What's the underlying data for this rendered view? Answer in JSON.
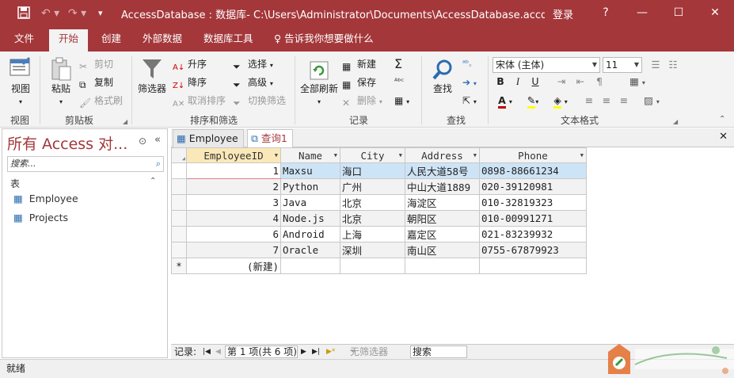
{
  "titlebar": {
    "title": "AccessDatabase : 数据库- C:\\Users\\Administrator\\Documents\\AccessDatabase.accdb (Acc...",
    "login": "登录",
    "help": "?",
    "minimize": "—",
    "restore": "☐",
    "close": "✕"
  },
  "menu": {
    "tabs": [
      "文件",
      "开始",
      "创建",
      "外部数据",
      "数据库工具"
    ],
    "tell_me": "告诉我你想要做什么"
  },
  "ribbon": {
    "view": {
      "label": "视图",
      "group": "视图"
    },
    "clipboard": {
      "paste": "粘贴",
      "cut": "剪切",
      "copy": "复制",
      "format_painter": "格式刷",
      "group": "剪贴板"
    },
    "sort_filter": {
      "filter": "筛选器",
      "asc": "升序",
      "desc": "降序",
      "remove_sort": "取消排序",
      "selection": "选择",
      "advanced": "高级",
      "toggle_filter": "切换筛选",
      "group": "排序和筛选"
    },
    "records": {
      "refresh": "全部刷新",
      "new": "新建",
      "save": "保存",
      "delete": "删除",
      "group": "记录"
    },
    "find": {
      "find": "查找",
      "group": "查找"
    },
    "text_format": {
      "font": "宋体 (主体)",
      "size": "11",
      "bold": "B",
      "italic": "I",
      "underline": "U",
      "group": "文本格式"
    },
    "colors": {
      "accent": "#a4373a",
      "font_color": "#c00000",
      "highlight": "#ffff00"
    }
  },
  "navpane": {
    "title": "所有 Access 对...",
    "search_placeholder": "搜索...",
    "group": "表",
    "items": [
      "Employee",
      "Projects"
    ]
  },
  "doctabs": [
    "Employee",
    "查询1"
  ],
  "grid": {
    "columns": [
      "EmployeeID",
      "Name",
      "City",
      "Address",
      "Phone"
    ],
    "rows": [
      [
        "1",
        "Maxsu",
        "海口",
        "人民大道58号",
        "0898-88661234"
      ],
      [
        "2",
        "Python",
        "广州",
        "中山大道1889",
        "020-39120981"
      ],
      [
        "3",
        "Java",
        "北京",
        "海淀区",
        "010-32819323"
      ],
      [
        "4",
        "Node.js",
        "北京",
        "朝阳区",
        "010-00991271"
      ],
      [
        "6",
        "Android",
        "上海",
        "嘉定区",
        "021-83239932"
      ],
      [
        "7",
        "Oracle",
        "深圳",
        "南山区",
        "0755-67879923"
      ]
    ],
    "new_row_marker": "*",
    "new_row_label": "(新建)"
  },
  "recnav": {
    "label": "记录:",
    "position": "第 1 项(共 6 项)",
    "filter": "无筛选器",
    "search": "搜索"
  },
  "status": {
    "text": "就绪"
  }
}
